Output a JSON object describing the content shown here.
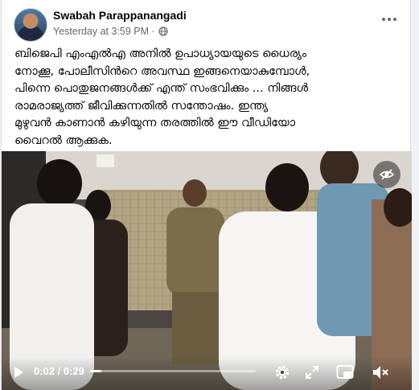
{
  "post": {
    "author": "Swabah Parappanangadi",
    "timestamp": "Yesterday at 3:59 PM",
    "separator": "·",
    "audience_icon": "globe-icon",
    "text": "ബിജെപി എംഎൽഎ അനിൽ ഉപാധ്യായയുടെ ധൈര്യം\nനോക്കൂ, പോലീസിൻറെ അവസ്ഥ ഇങ്ങനെയാകുമ്പോൾ,\nപിന്നെ പൊതുജനങ്ങൾക്ക് എന്ത് സംഭവിക്കും ... നിങ്ങൾ\nരാമരാജ്യത്ത് ജീവിക്കുന്നതിൽ സന്തോഷം. ഇന്ത്യ\nമുഴുവൻ കാണാൻ കഴിയുന്ന തരത്തിൽ ഈ വീഡിയോ\nവൈറൽ ആക്കുക."
  },
  "video": {
    "current_time": "0:02",
    "time_separator": " / ",
    "duration": "0:29",
    "progress_fraction": 0.07,
    "icons": [
      "play-icon",
      "settings-icon",
      "fullscreen-icon",
      "picture-in-picture-icon",
      "volume-icon",
      "hide-eye-icon"
    ]
  }
}
